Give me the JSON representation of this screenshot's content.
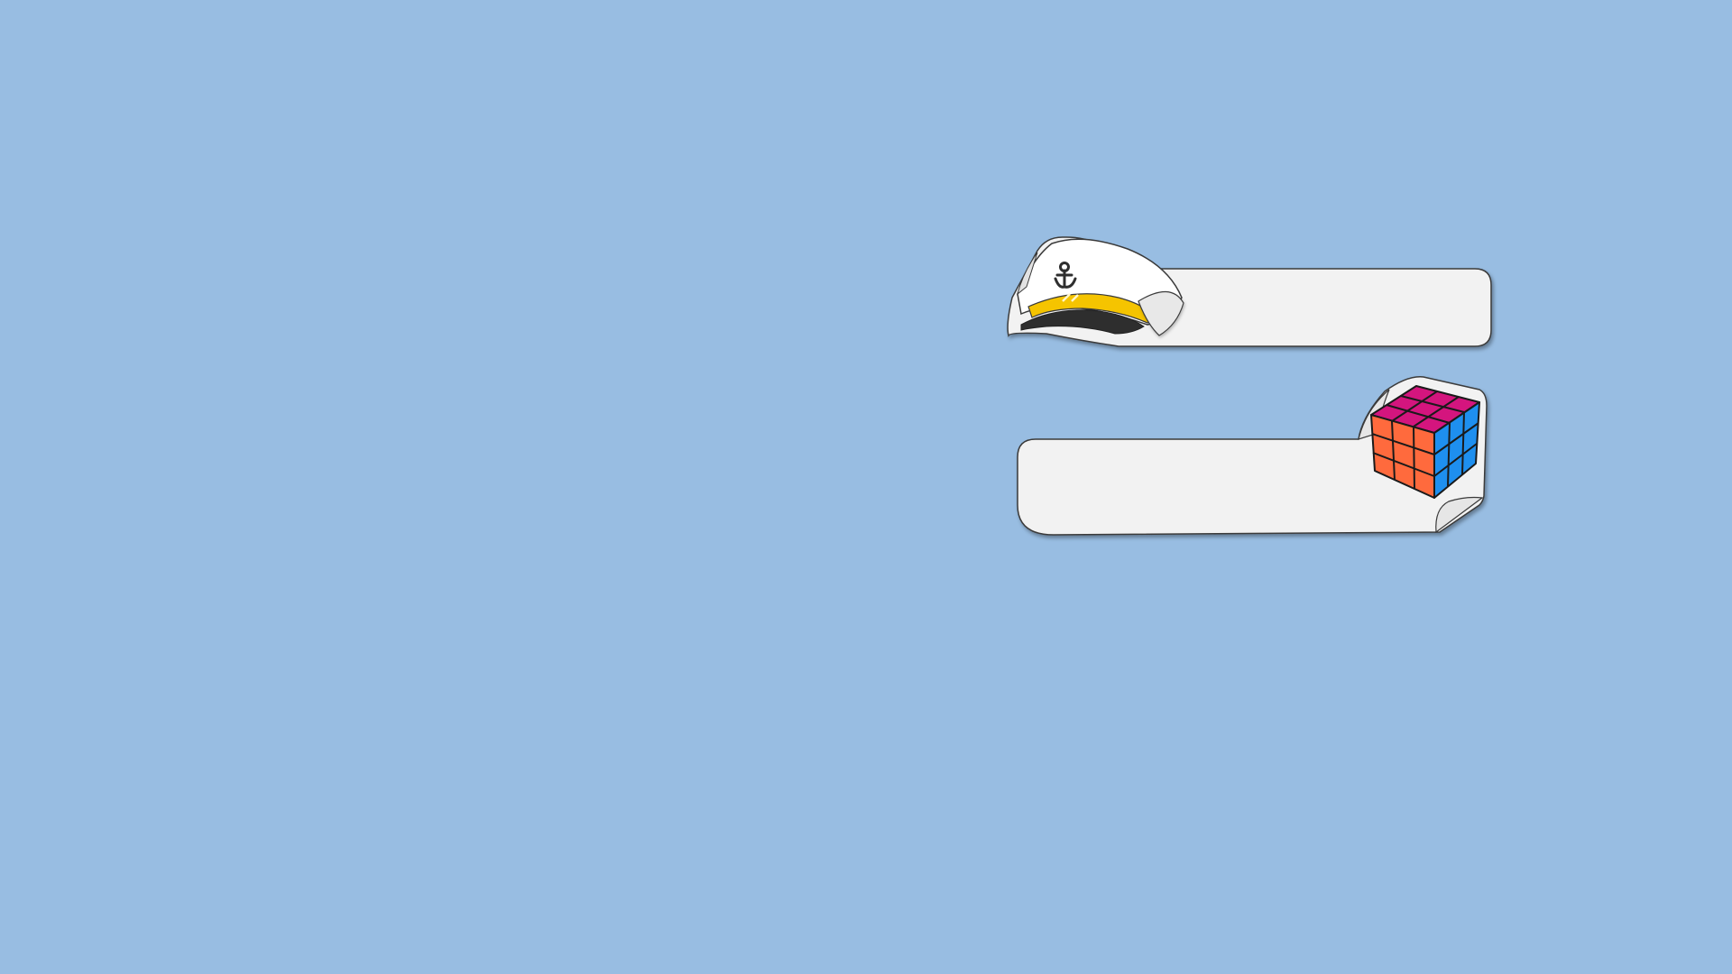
{
  "background": {
    "color": "#98BDE2"
  },
  "labels": [
    {
      "name": "captain-hat-label",
      "icon": "captain-hat-icon",
      "text": ""
    },
    {
      "name": "rubiks-cube-label",
      "icon": "rubiks-cube-icon",
      "text": ""
    }
  ],
  "colors": {
    "label_fill": "#F2F2F2",
    "label_stroke": "#3A3A3A",
    "hat_band": "#F5C400",
    "hat_visor": "#2E2E2E",
    "cube_top": "#D4157E",
    "cube_left": "#FF6A3D",
    "cube_right": "#1E8FEF"
  }
}
